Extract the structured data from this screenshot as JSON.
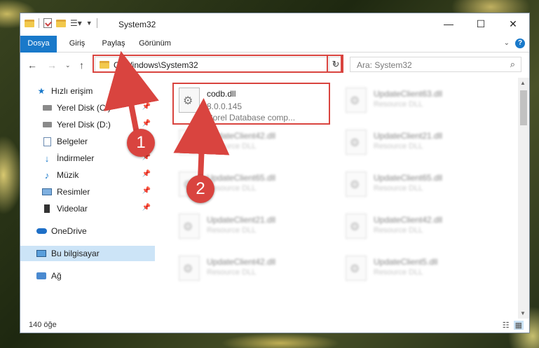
{
  "window": {
    "title": "System32"
  },
  "ribbon": {
    "tabs": [
      "Dosya",
      "Giriş",
      "Paylaş",
      "Görünüm"
    ],
    "help": "?"
  },
  "nav": {
    "address": "C:\\Windows\\System32",
    "search_placeholder": "Ara: System32"
  },
  "sidebar": {
    "items": [
      {
        "label": "Hızlı erişim",
        "icon": "star-icon"
      },
      {
        "label": "Yerel Disk (C:)",
        "icon": "disk-icon",
        "pinned": true
      },
      {
        "label": "Yerel Disk (D:)",
        "icon": "disk-icon",
        "pinned": true
      },
      {
        "label": "Belgeler",
        "icon": "documents-icon",
        "pinned": true
      },
      {
        "label": "İndirmeler",
        "icon": "downloads-icon",
        "pinned": true
      },
      {
        "label": "Müzik",
        "icon": "music-icon",
        "pinned": true
      },
      {
        "label": "Resimler",
        "icon": "pictures-icon",
        "pinned": true
      },
      {
        "label": "Videolar",
        "icon": "videos-icon",
        "pinned": true
      },
      {
        "label": "OneDrive",
        "icon": "onedrive-icon"
      },
      {
        "label": "Bu bilgisayar",
        "icon": "this-pc-icon",
        "selected": true
      },
      {
        "label": "Ağ",
        "icon": "network-icon"
      }
    ]
  },
  "files": {
    "highlighted": {
      "name": "codb.dll",
      "version": "8.0.0.145",
      "description": "Corel Database comp..."
    },
    "others": [
      {
        "name": "UpdateClient63.dll",
        "desc": "Resource DLL"
      },
      {
        "name": "UpdateClient42.dll",
        "desc": "Resource DLL"
      },
      {
        "name": "UpdateClient21.dll",
        "desc": "Resource DLL"
      },
      {
        "name": "UpdateClient65.dll",
        "desc": "Resource DLL"
      },
      {
        "name": "UpdateClient65.dll",
        "desc": "Resource DLL"
      },
      {
        "name": "UpdateClient21.dll",
        "desc": "Resource DLL"
      },
      {
        "name": "UpdateClient42.dll",
        "desc": "Resource DLL"
      },
      {
        "name": "UpdateClient42.dll",
        "desc": "Resource DLL"
      },
      {
        "name": "UpdateClient5.dll",
        "desc": "Resource DLL"
      }
    ]
  },
  "status": {
    "count": "140 öğe"
  },
  "annotations": {
    "step1": "1",
    "step2": "2"
  },
  "colors": {
    "accent": "#1979ca",
    "highlight": "#d9443f"
  }
}
